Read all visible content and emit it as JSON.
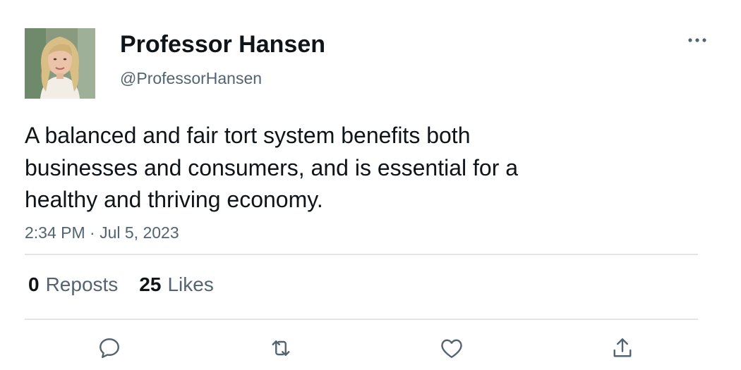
{
  "author": {
    "name": "Professor Hansen",
    "handle": "@ProfessorHansen"
  },
  "tweet": {
    "text": "A balanced and fair tort system benefits both businesses and consumers, and is essential for a healthy and thriving economy.",
    "timestamp": "2:34 PM · Jul 5, 2023"
  },
  "stats": {
    "reposts_count": "0",
    "reposts_label": "Reposts",
    "likes_count": "25",
    "likes_label": "Likes"
  },
  "icons": {
    "more": "more-horizontal-icon",
    "reply": "reply-icon",
    "repost": "repost-icon",
    "like": "heart-icon",
    "share": "share-icon"
  },
  "colors": {
    "text": "#0f1419",
    "secondary": "#536471",
    "divider": "#e1e5e8"
  }
}
